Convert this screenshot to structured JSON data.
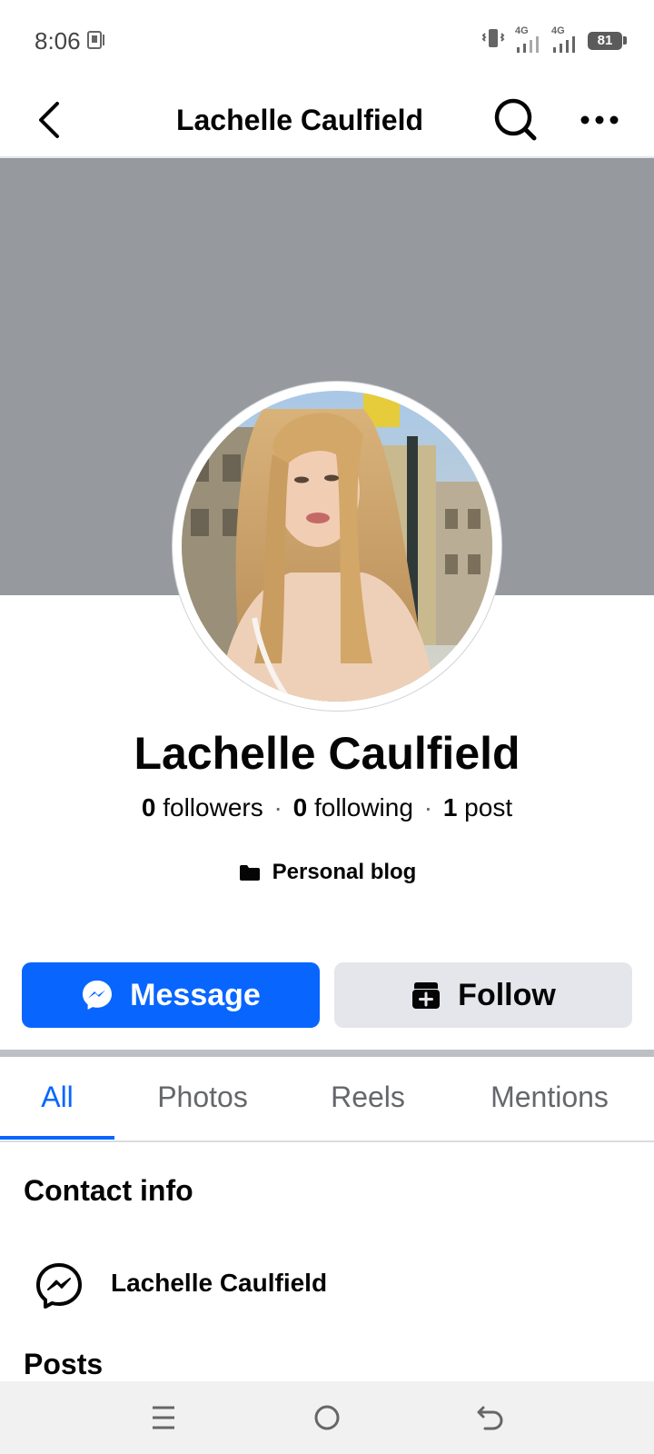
{
  "status_bar": {
    "time": "8:06",
    "battery": "81",
    "network_1": "4G",
    "network_2": "4G",
    "icons": [
      "nfc-icon",
      "vibrate-icon",
      "signal-icon",
      "signal-icon",
      "battery-icon"
    ]
  },
  "header": {
    "title": "Lachelle Caulfield",
    "icons": [
      "back-arrow-icon",
      "search-icon",
      "more-icon"
    ]
  },
  "profile": {
    "name": "Lachelle Caulfield",
    "followers_count": "0",
    "followers_label": "followers",
    "following_count": "0",
    "following_label": "following",
    "posts_count": "1",
    "posts_label": "post",
    "separator": "·",
    "category": "Personal blog"
  },
  "actions": {
    "message_label": "Message",
    "follow_label": "Follow"
  },
  "tabs": [
    {
      "label": "All",
      "active": true
    },
    {
      "label": "Photos",
      "active": false
    },
    {
      "label": "Reels",
      "active": false
    },
    {
      "label": "Mentions",
      "active": false
    }
  ],
  "contact_info": {
    "title": "Contact info",
    "messenger_name": "Lachelle Caulfield"
  },
  "posts": {
    "title": "Posts"
  },
  "colors": {
    "accent": "#0866ff",
    "cover": "#969a9f",
    "secondary_button": "#e4e6eb",
    "muted_text": "#65676b"
  },
  "nav_bar": {
    "icons": [
      "recent-apps-icon",
      "home-icon",
      "back-icon"
    ]
  }
}
